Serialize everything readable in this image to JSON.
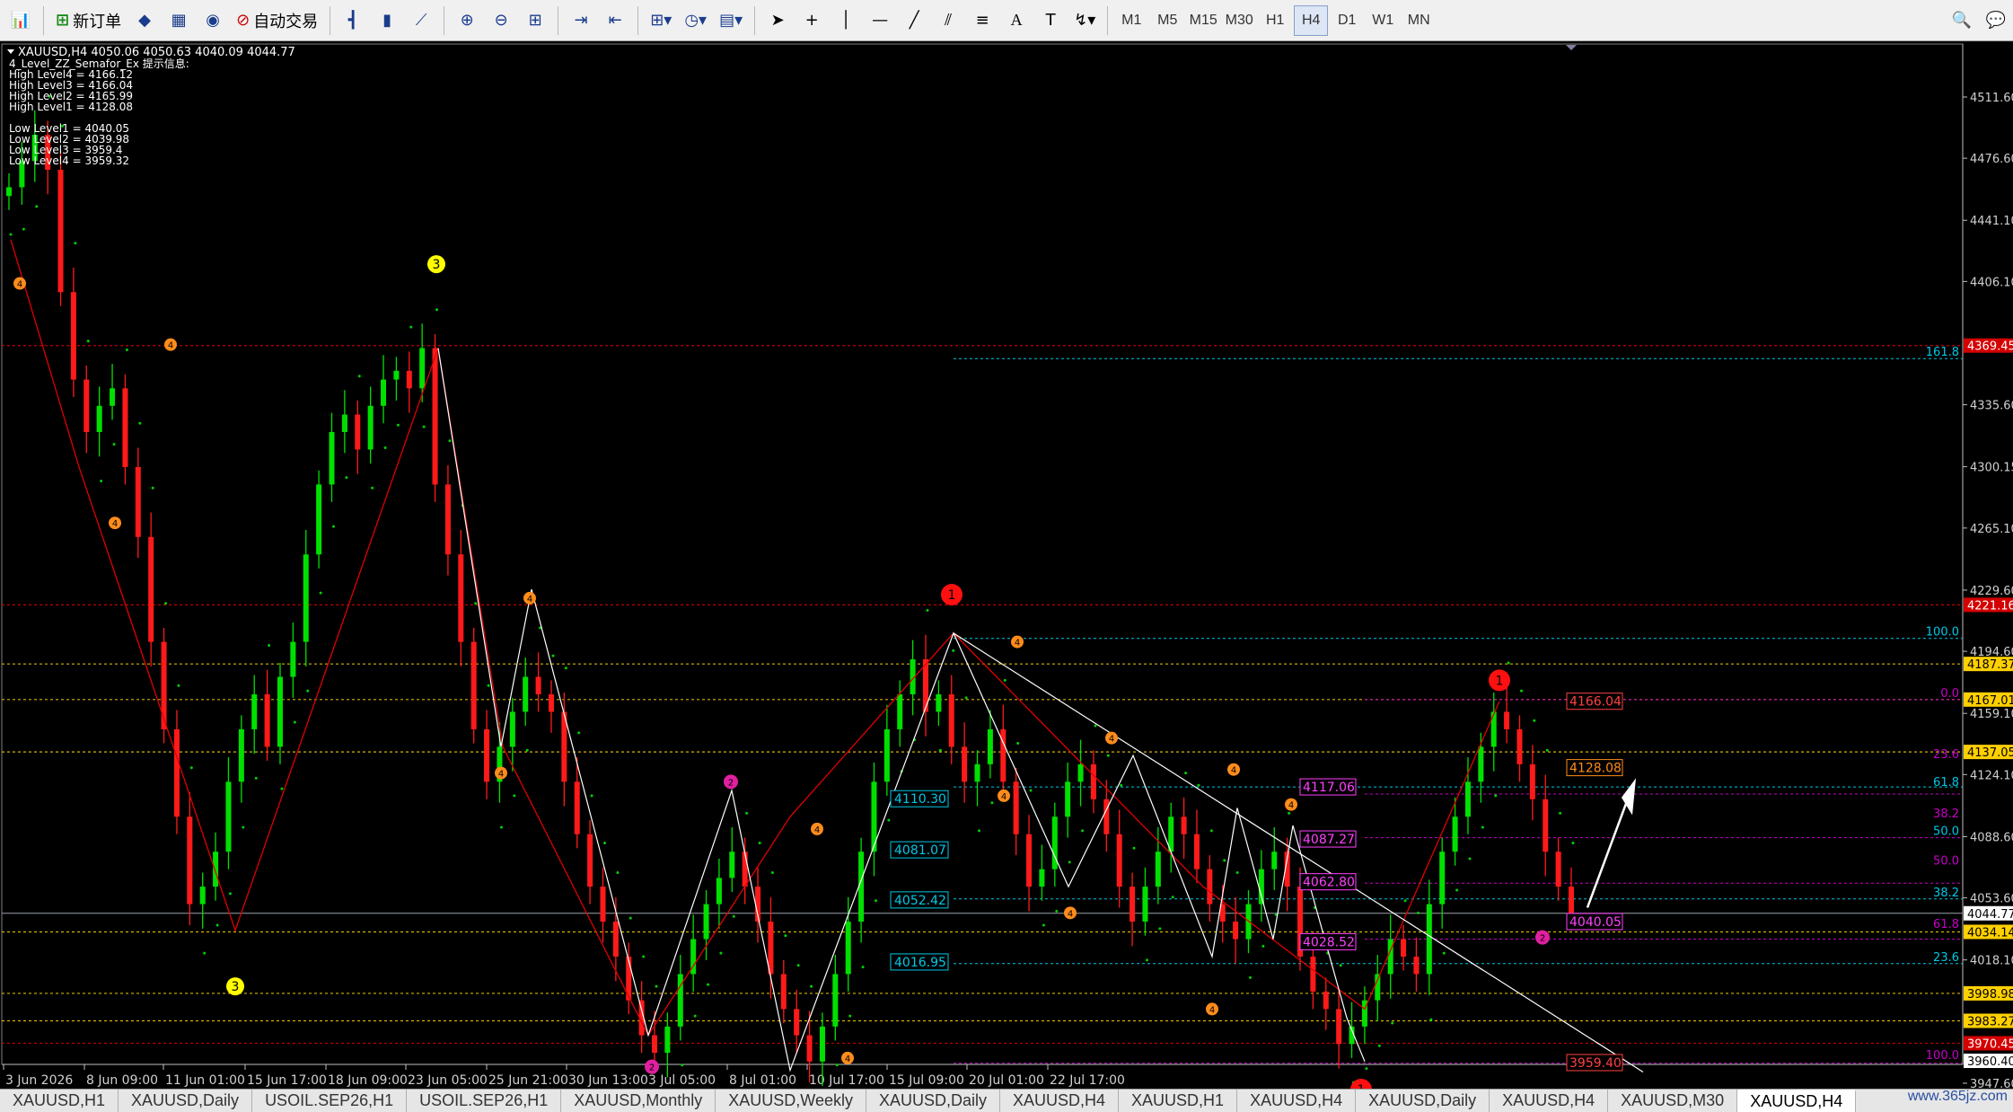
{
  "toolbar": {
    "new_order_label": "新订单",
    "auto_trade_label": "自动交易",
    "timeframes": [
      "M1",
      "M5",
      "M15",
      "M30",
      "H1",
      "H4",
      "D1",
      "W1",
      "MN"
    ],
    "active_timeframe": "H4"
  },
  "chart": {
    "header": "XAUUSD,H4  4050.06 4050.63 4040.09 4044.77",
    "indicator_title": "4_Level_ZZ_Semafor_Ex 提示信息:",
    "info_lines": [
      "High Level4 = 4166.12",
      "High Level3 = 4166.04",
      "High Level2 = 4165.99",
      "High Level1 = 4128.08",
      "",
      "Low Level1 = 4040.05",
      "Low Level2 = 4039.98",
      "Low Level3 = 3959.4",
      "Low Level4 = 3959.32"
    ],
    "price_ticks": [
      "4511.60",
      "4476.60",
      "4441.10",
      "4406.10",
      "4335.60",
      "4300.15",
      "4265.10",
      "4229.60",
      "4194.60",
      "4159.10",
      "4124.10",
      "4088.60",
      "4053.60",
      "4018.10",
      "3947.60"
    ],
    "price_boxes": [
      {
        "label": "4369.45",
        "color": "#d40000",
        "text_color": "#ffffff"
      },
      {
        "label": "4221.16",
        "color": "#d40000",
        "text_color": "#ffffff"
      },
      {
        "label": "4187.37",
        "color": "#ffd000",
        "text_color": "#000000"
      },
      {
        "label": "4167.01",
        "color": "#ffd000",
        "text_color": "#000000"
      },
      {
        "label": "4137.05",
        "color": "#ffd000",
        "text_color": "#000000"
      },
      {
        "label": "4044.77",
        "color": "#ffffff",
        "text_color": "#000000"
      },
      {
        "label": "4034.14",
        "color": "#ffd000",
        "text_color": "#000000"
      },
      {
        "label": "3998.98",
        "color": "#ffd000",
        "text_color": "#000000"
      },
      {
        "label": "3983.27",
        "color": "#ffd000",
        "text_color": "#000000"
      },
      {
        "label": "3970.45",
        "color": "#d40000",
        "text_color": "#ffffff"
      },
      {
        "label": "3960.40",
        "color": "#ffffff",
        "text_color": "#000000"
      }
    ],
    "fib_right": [
      {
        "label": "161.8",
        "color": "#00c8e6"
      },
      {
        "label": "100.0",
        "color": "#00c8e6"
      },
      {
        "label": "0.0",
        "color": "#c800c8"
      },
      {
        "label": "23.6",
        "color": "#c800c8"
      },
      {
        "label": "61.8",
        "color": "#00c8e6"
      },
      {
        "label": "38.2",
        "color": "#c800c8"
      },
      {
        "label": "50.0",
        "color": "#00c8e6"
      },
      {
        "label": "50.0",
        "color": "#c800c8"
      },
      {
        "label": "38.2",
        "color": "#00c8e6"
      },
      {
        "label": "61.8",
        "color": "#c800c8"
      },
      {
        "label": "23.6",
        "color": "#00c8e6"
      },
      {
        "label": "100.0",
        "color": "#c800c8"
      }
    ],
    "level_boxes_cyan": [
      "4110.30",
      "4081.07",
      "4052.42",
      "4016.95"
    ],
    "level_boxes_magenta": [
      "4117.06",
      "4087.27",
      "4062.80",
      "4028.52"
    ],
    "level_boxes_right": [
      {
        "label": "4166.04",
        "color": "#ff4040"
      },
      {
        "label": "4128.08",
        "color": "#ff8c1a"
      },
      {
        "label": "4040.05",
        "color": "#ff40ff"
      },
      {
        "label": "3959.40",
        "color": "#ff4040"
      }
    ],
    "date_ticks": [
      "3 Jun 2026",
      "8 Jun 09:00",
      "11 Jun 01:00",
      "15 Jun 17:00",
      "18 Jun 09:00",
      "23 Jun 05:00",
      "25 Jun 21:00",
      "30 Jun 13:00",
      "3 Jul 05:00",
      "8 Jul 01:00",
      "10 Jul 17:00",
      "15 Jul 09:00",
      "20 Jul 01:00",
      "22 Jul 17:00"
    ],
    "semafor_labels": [
      "1",
      "2",
      "3",
      "4"
    ]
  },
  "tabs": [
    "XAUUSD,H1",
    "XAUUSD,Daily",
    "USOIL.SEP26,H1",
    "USOIL.SEP26,H1",
    "XAUUSD,Monthly",
    "XAUUSD,Weekly",
    "XAUUSD,Daily",
    "XAUUSD,H4",
    "XAUUSD,H1",
    "XAUUSD,H4",
    "XAUUSD,Daily",
    "XAUUSD,H4",
    "XAUUSD,M30",
    "XAUUSD,H4"
  ],
  "active_tab_index": 13,
  "watermark": "www.365jz.com",
  "colors": {
    "bull": "#00e000",
    "bear": "#ff1a1a",
    "zigzag_red": "#e00000",
    "zigzag_white": "#ffffff",
    "fib_cyan": "#00c8e6",
    "fib_magenta": "#c800c8",
    "dotted_yellow": "#d6b400",
    "dotted_red": "#c00000"
  }
}
